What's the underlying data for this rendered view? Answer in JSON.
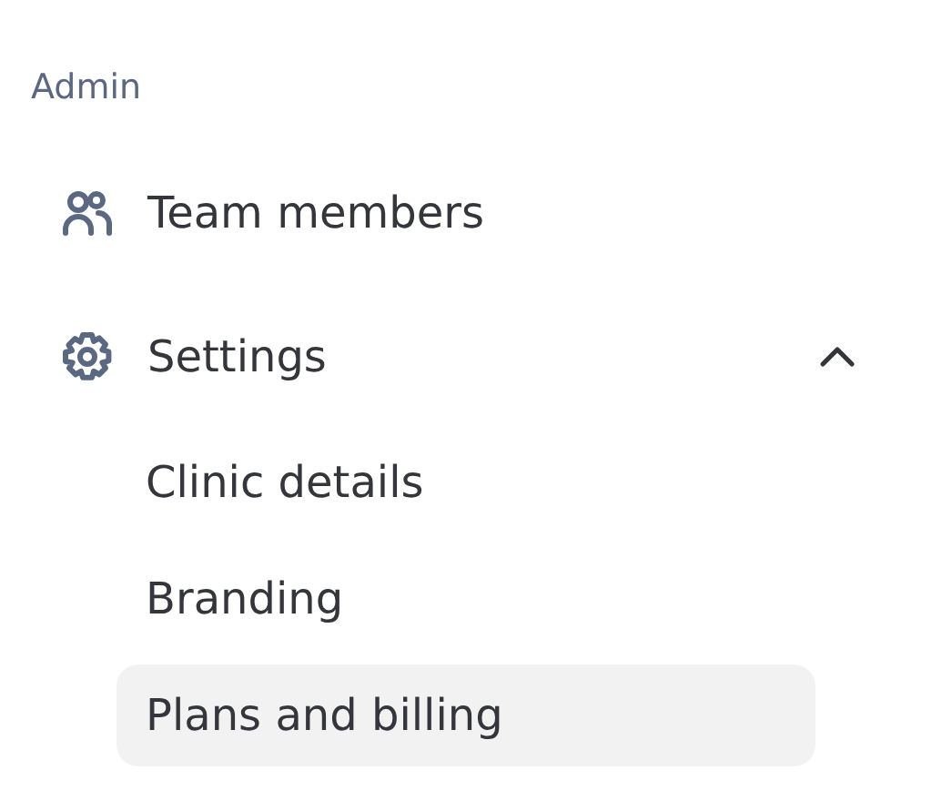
{
  "section_label": "Admin",
  "items": [
    {
      "label": "Team members"
    },
    {
      "label": "Settings",
      "expanded": true,
      "children": [
        {
          "label": "Clinic details",
          "selected": false
        },
        {
          "label": "Branding",
          "selected": false
        },
        {
          "label": "Plans and billing",
          "selected": true
        }
      ]
    }
  ]
}
